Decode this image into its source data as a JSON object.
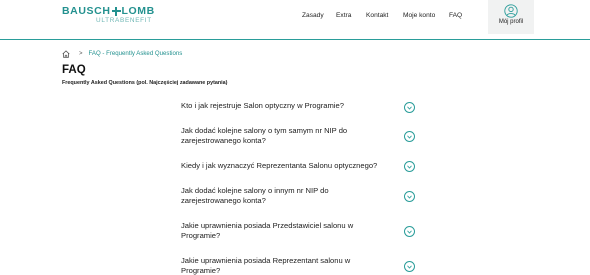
{
  "brand": {
    "name_left": "BAUSCH",
    "name_right": "LOMB",
    "subtitle": "ULTRABENEFIT",
    "accent_color": "#23918f"
  },
  "nav": {
    "items": [
      {
        "label": "Zasady"
      },
      {
        "label": "Extra"
      },
      {
        "label": "Kontakt"
      },
      {
        "label": "Moje konto"
      },
      {
        "label": "FAQ"
      }
    ],
    "profile_label": "Mój profil",
    "profile_icon": "user-circle-icon"
  },
  "breadcrumb": {
    "home_icon": "home-icon",
    "separator": ">",
    "current": "FAQ - Frequently Asked Questions"
  },
  "page": {
    "title": "FAQ",
    "subtitle": "Frequently Asked Questions (pol. Najczęściej zadawane pytania)"
  },
  "faq": {
    "toggle_icon": "chevron-down-icon",
    "items": [
      {
        "question": "Kto i jak rejestruje Salon optyczny w Programie?"
      },
      {
        "question": "Jak dodać kolejne salony o tym samym nr NIP do zarejestrowanego konta?"
      },
      {
        "question": "Kiedy i jak wyznaczyć Reprezentanta Salonu optycznego?"
      },
      {
        "question": "Jak dodać kolejne salony o innym nr NIP do zarejestrowanego konta?"
      },
      {
        "question": "Jakie uprawnienia posiada Przedstawiciel salonu w Programie?"
      },
      {
        "question": "Jakie uprawnienia posiada Reprezentant salonu w Programie?"
      }
    ]
  }
}
